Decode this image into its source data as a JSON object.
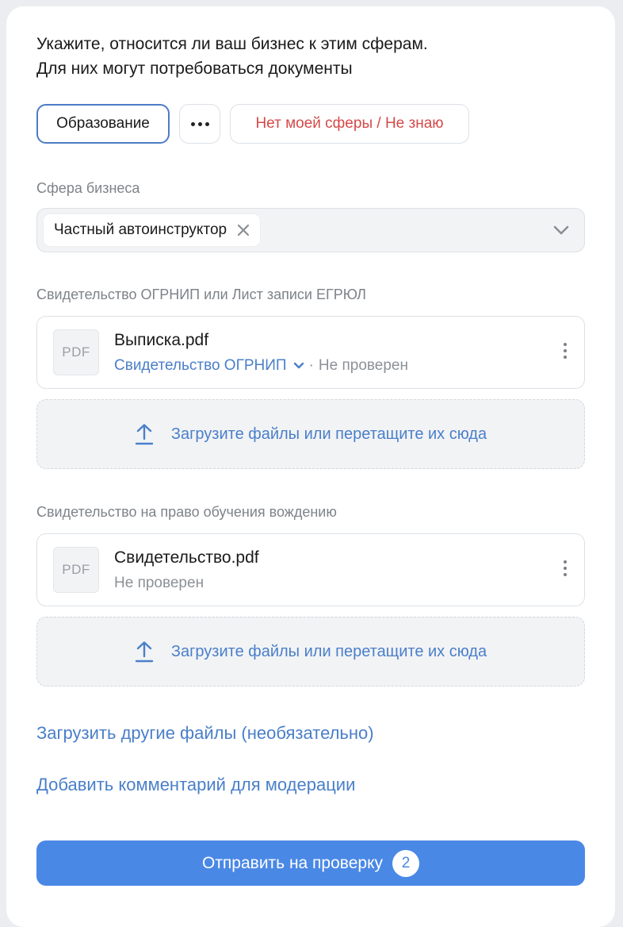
{
  "header": {
    "line1": "Укажите, относится ли ваш бизнес к этим сферам.",
    "line2": "Для них могут потребоваться документы"
  },
  "chips": {
    "selected": "Образование",
    "more": "more-dots-icon",
    "none": "Нет моей сферы / Не знаю"
  },
  "business": {
    "label": "Сфера бизнеса",
    "tag": "Частный автоинструктор"
  },
  "section1": {
    "label": "Свидетельство ОГРНИП или Лист записи ЕГРЮЛ",
    "file": {
      "badge": "PDF",
      "name": "Выписка.pdf",
      "type": "Свидетельство ОГРНИП",
      "separator": "·",
      "status": "Не проверен"
    },
    "upload": "Загрузите файлы или перетащите их сюда"
  },
  "section2": {
    "label": "Свидетельство на право обучения вождению",
    "file": {
      "badge": "PDF",
      "name": "Свидетельство.pdf",
      "status": "Не проверен"
    },
    "upload": "Загрузите файлы или перетащите их сюда"
  },
  "links": {
    "other_files": "Загрузить другие файлы (необязательно)",
    "comment": "Добавить комментарий для модерации"
  },
  "submit": {
    "label": "Отправить на проверку",
    "count": "2"
  },
  "colors": {
    "accent": "#4a88e6",
    "link": "#4a7fc9",
    "danger": "#d44a48"
  }
}
